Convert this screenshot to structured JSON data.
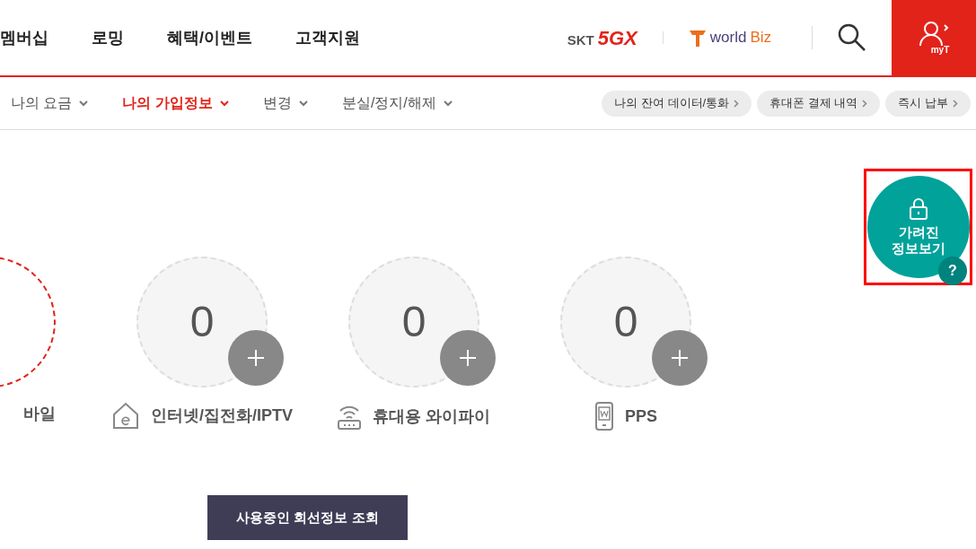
{
  "top_nav": {
    "items": [
      "멤버십",
      "로밍",
      "혜택/이벤트",
      "고객지원"
    ],
    "logos": [
      {
        "kind": "skt",
        "text": "SKT",
        "mark": "5GX"
      },
      {
        "kind": "worldbiz",
        "text": "world",
        "mark": "Biz"
      }
    ],
    "myt_label": "myT"
  },
  "sub_nav": {
    "tabs": [
      {
        "label": "나의 요금",
        "selected": false
      },
      {
        "label": "나의 가입정보",
        "selected": true
      },
      {
        "label": "변경",
        "selected": false
      },
      {
        "label": "분실/정지/해제",
        "selected": false
      }
    ],
    "shortcuts": [
      "나의 잔여 데이터/통화",
      "휴대폰 결제 내역",
      "즉시 납부"
    ]
  },
  "hidden_info_button": {
    "label_line1": "가려진",
    "label_line2": "정보보기",
    "help": "?"
  },
  "lines": [
    {
      "kind": "mobile",
      "label": "바일",
      "selected": true
    },
    {
      "kind": "internet",
      "count": "0",
      "label": "인터넷/집전화/IPTV",
      "selected": false
    },
    {
      "kind": "wifi",
      "count": "0",
      "label": "휴대용 와이파이",
      "selected": false
    },
    {
      "kind": "pps",
      "count": "0",
      "label": "PPS",
      "selected": false
    }
  ],
  "lookup_button": "사용중인 회선정보 조회"
}
